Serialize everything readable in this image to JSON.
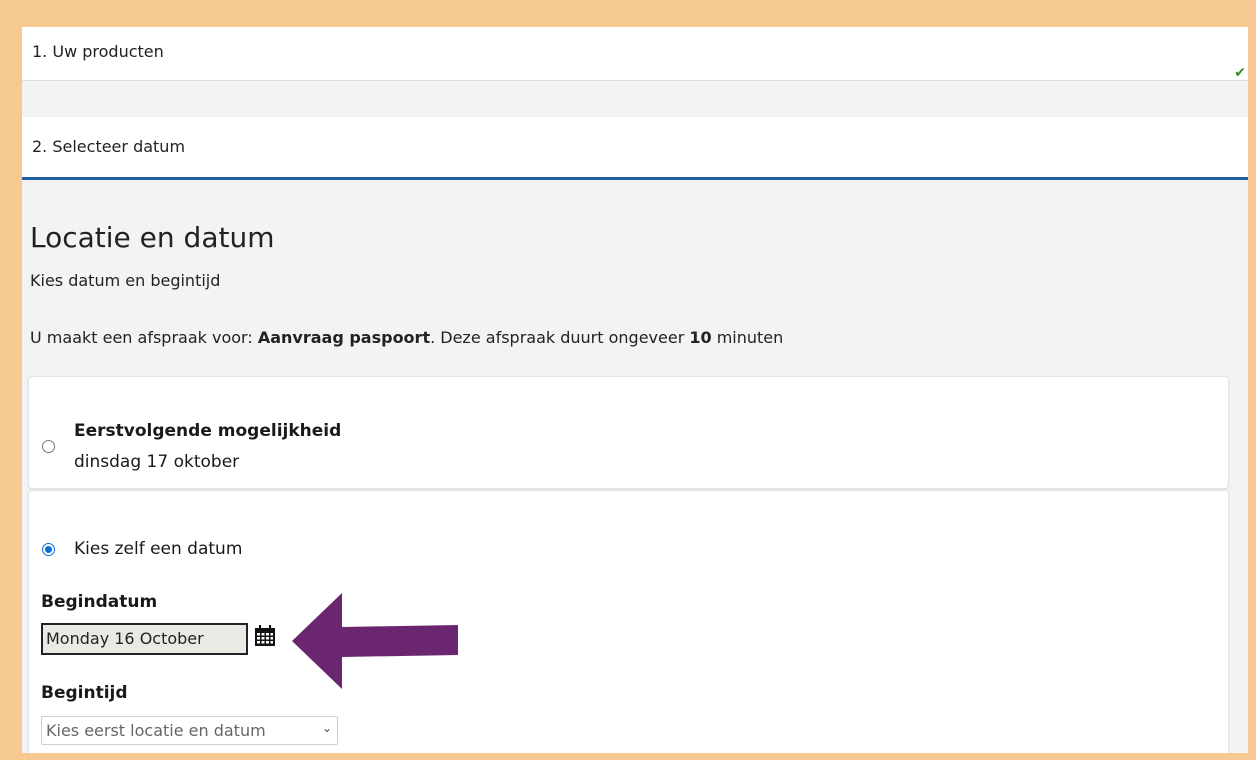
{
  "steps": {
    "step1_label": "1. Uw producten",
    "step1_check": "✔",
    "step2_label": "2. Selecteer datum"
  },
  "main": {
    "title": "Locatie en datum",
    "subtitle": "Kies datum en begintijd",
    "info_prefix": "U maakt een afspraak voor: ",
    "product": "Aanvraag paspoort",
    "info_middle": ". Deze afspraak duurt ongeveer ",
    "duration": "10",
    "info_suffix": " minuten"
  },
  "options": {
    "first_title": "Eerstvolgende mogelijkheid",
    "first_date": "dinsdag 17 oktober",
    "first_selected": false,
    "own_label": "Kies zelf een datum",
    "own_selected": true
  },
  "form": {
    "start_date_label": "Begindatum",
    "start_date_value": "Monday 16 October",
    "start_time_label": "Begintijd",
    "start_time_placeholder": "Kies eerst locatie en datum"
  },
  "icons": {
    "checkmark": "check-icon",
    "calendar": "calendar-icon",
    "chevron": "chevron-down-icon",
    "arrow": "arrow-left-annotation"
  },
  "colors": {
    "background": "#f5c991",
    "accent": "#1f5fa3",
    "radio": "#0b6fd3",
    "arrow": "#6b2670",
    "check": "#3a8a2a"
  }
}
